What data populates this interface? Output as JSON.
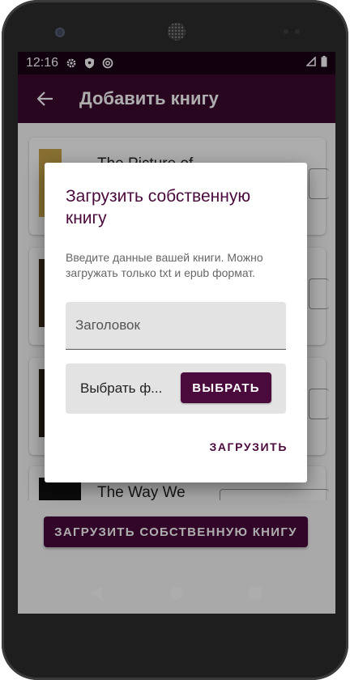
{
  "status_bar": {
    "time": "12:16",
    "icons": [
      "gear-icon",
      "shield-icon",
      "sync-icon"
    ],
    "right_icons": [
      "signal-icon",
      "battery-icon"
    ]
  },
  "app_bar": {
    "back_icon": "arrow-left-icon",
    "title": "Добавить книгу"
  },
  "books": [
    {
      "title": "The Picture of"
    },
    {
      "title": ""
    },
    {
      "title": ""
    },
    {
      "title": "The Way We"
    }
  ],
  "bottom": {
    "upload_own_label": "ЗАГРУЗИТЬ СОБСТВЕННУЮ КНИГУ"
  },
  "dialog": {
    "title": "Загрузить собственную книгу",
    "description": "Введите данные вашей книги. Можно загружать только txt и epub формат.",
    "title_field_placeholder": "Заголовок",
    "title_field_value": "",
    "file_label": "Выбрать ф...",
    "choose_label": "ВЫБРАТЬ",
    "upload_label": "ЗАГРУЗИТЬ"
  },
  "colors": {
    "primary": "#4a0a3c",
    "app_bar": "#3b0a30",
    "status_bar": "#1a0215"
  }
}
